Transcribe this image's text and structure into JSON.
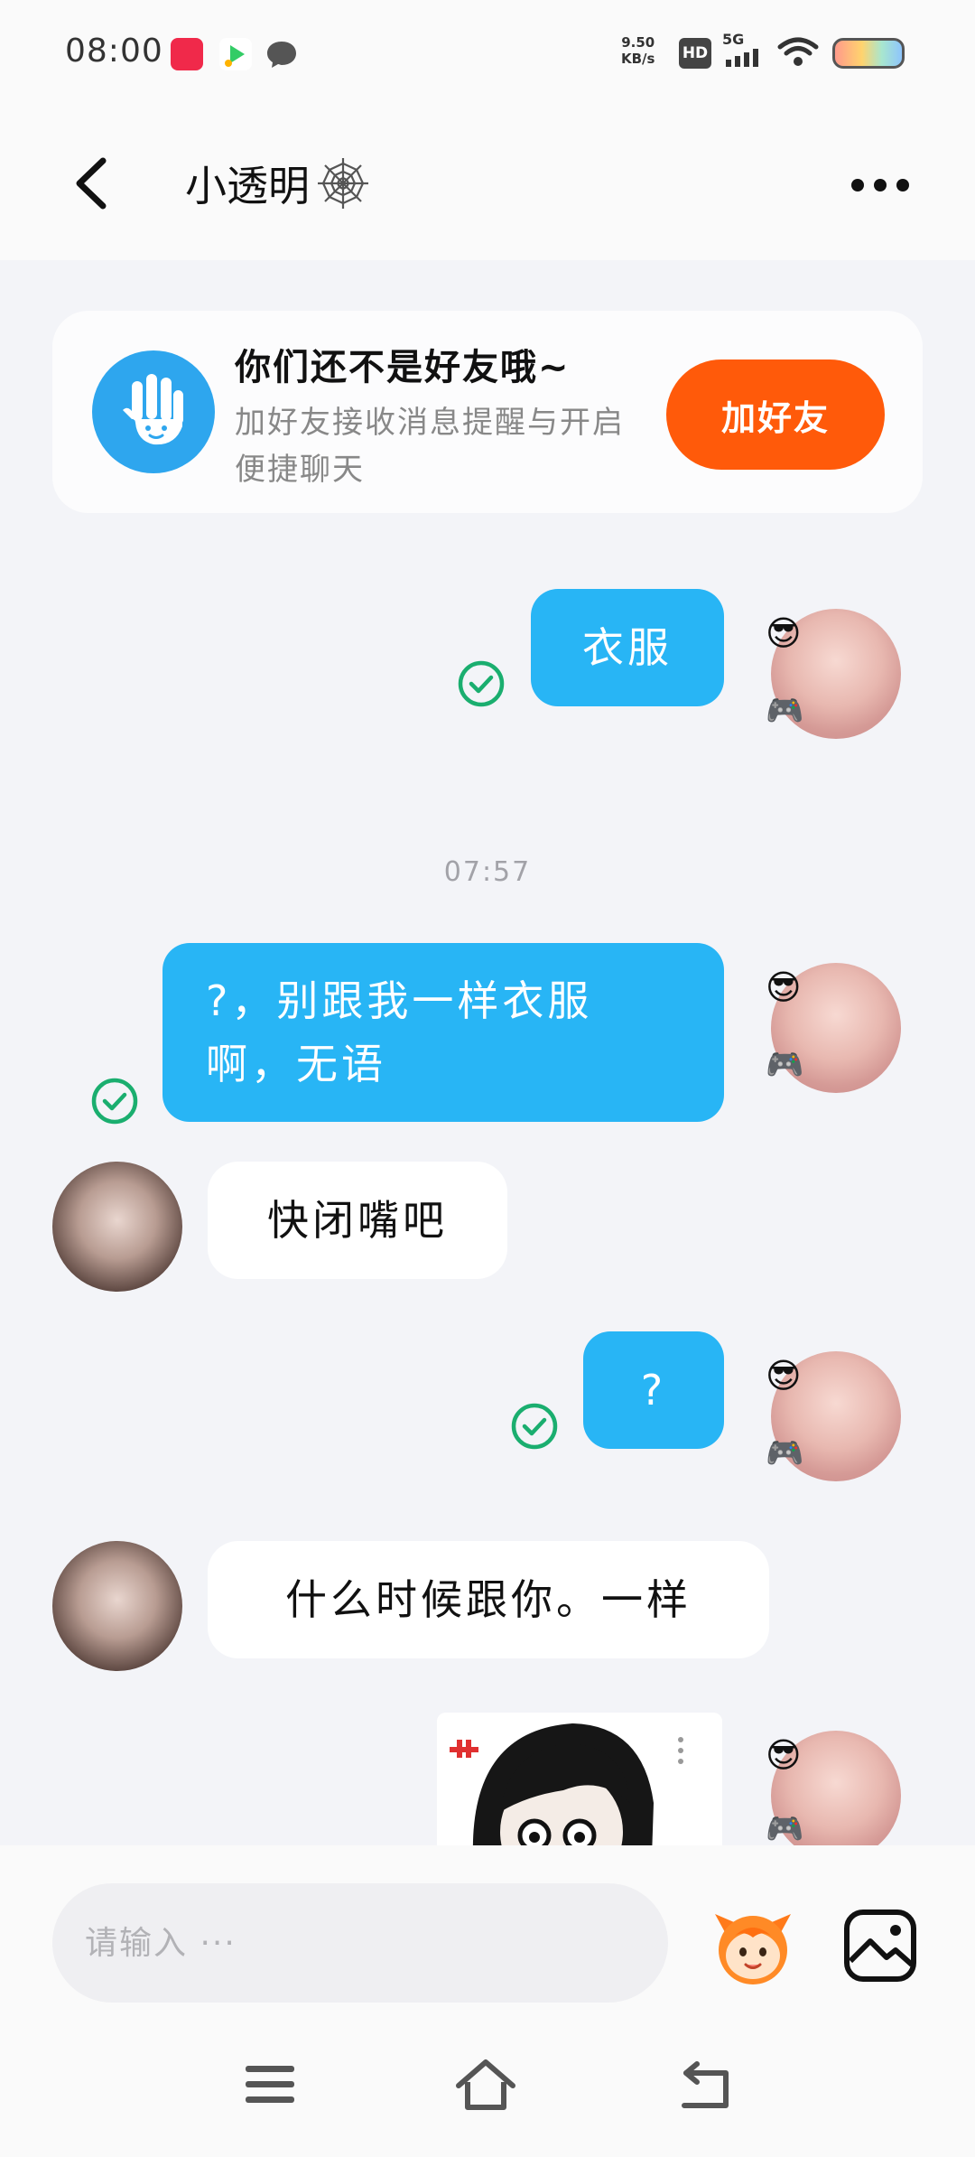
{
  "status_bar": {
    "time": "08:00",
    "network_speed_value": "9.50",
    "network_speed_unit": "KB/s",
    "hd_label": "HD",
    "signal_label": "5G",
    "icons": [
      "app-badge-red-icon",
      "video-app-icon",
      "chat-bubble-icon",
      "signal-icon",
      "wifi-icon",
      "battery-icon"
    ]
  },
  "header": {
    "title": "小透明",
    "title_decoration_icon": "spider-web-icon",
    "back_icon": "chevron-left-icon",
    "more_icon": "more-dots-icon"
  },
  "friend_card": {
    "title": "你们还不是好友哦~",
    "description": "加好友接收消息提醒与开启便捷聊天",
    "button_label": "加好友",
    "icon": "waving-hand-icon"
  },
  "messages": [
    {
      "from": "me",
      "text": "衣服",
      "read": true
    },
    {
      "from": "me",
      "text": "?，别跟我一样衣服啊，无语",
      "read": true
    },
    {
      "from": "other",
      "text": "快闭嘴吧"
    },
    {
      "from": "me",
      "text": "?",
      "read": true
    },
    {
      "from": "other",
      "text": "什么时候跟你。一样"
    },
    {
      "from": "me",
      "type": "image",
      "image": "sticker-image"
    }
  ],
  "timestamp": "07:57",
  "input": {
    "placeholder": "请输入 ···",
    "value": ""
  },
  "colors": {
    "accent": "#28b5f5",
    "add_friend": "#ff5a0a",
    "read_check": "#1aae6f",
    "background": "#f3f4f8"
  },
  "nav_bar": {
    "icons": [
      "menu-icon",
      "home-icon",
      "back-icon"
    ]
  }
}
